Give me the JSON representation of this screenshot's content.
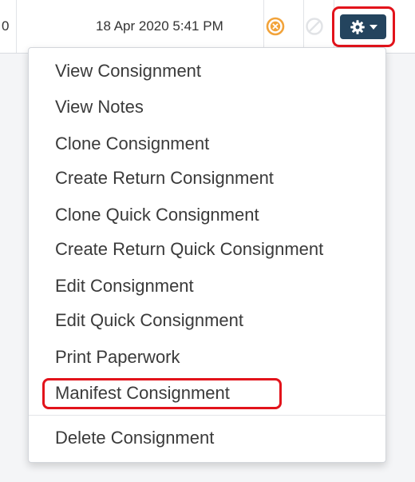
{
  "row": {
    "left_value": "0",
    "date": "18 Apr 2020 5:41 PM",
    "status_icon": "cancel-circle-icon",
    "disabled_icon": "disabled-circle-icon",
    "gear_icon": "gear-icon",
    "caret_icon": "caret-down-icon"
  },
  "menu": {
    "items": [
      {
        "label": "View Consignment"
      },
      {
        "label": "View Notes"
      },
      {
        "label": "Clone Consignment"
      },
      {
        "label": "Create Return Consignment"
      },
      {
        "label": "Clone Quick Consignment"
      },
      {
        "label": "Create Return Quick Consignment"
      },
      {
        "label": "Edit Consignment"
      },
      {
        "label": "Edit Quick Consignment"
      },
      {
        "label": "Print Paperwork"
      },
      {
        "label": "Manifest Consignment"
      },
      {
        "label": "Delete Consignment"
      }
    ]
  },
  "colors": {
    "highlight": "#e2131b",
    "gear_button": "#24445e",
    "status_orange": "#f2a33a"
  }
}
